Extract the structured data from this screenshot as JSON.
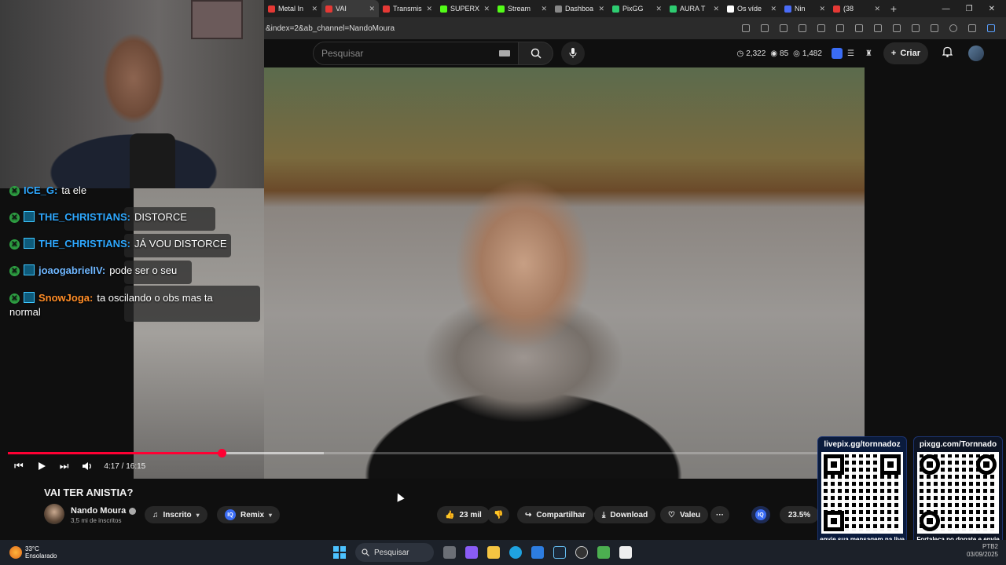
{
  "browser": {
    "tabs": [
      {
        "label": "Metal In",
        "color": "#e53935"
      },
      {
        "label": "VAI",
        "color": "#e53935",
        "active": true
      },
      {
        "label": "Transmis",
        "color": "#e53935"
      },
      {
        "label": "SUPERX",
        "color": "#53fc18"
      },
      {
        "label": "Stream",
        "color": "#53fc18"
      },
      {
        "label": "Dashboa",
        "color": "#888888"
      },
      {
        "label": "PixGG",
        "color": "#2ecc71"
      },
      {
        "label": "AURA T",
        "color": "#2ecc71"
      },
      {
        "label": "Os víde",
        "color": "#ffffff"
      },
      {
        "label": "Nin",
        "color": "#4a6cf7"
      },
      {
        "label": "(38",
        "color": "#e53935"
      }
    ],
    "new_tab": "+",
    "url": "&index=2&ab_channel=NandoMoura"
  },
  "youtube": {
    "search_placeholder": "Pesquisar",
    "stats": {
      "a": "2,322",
      "b": "85",
      "c": "1,482"
    },
    "create_label": "Criar"
  },
  "chat": [
    {
      "user": "ICE_G:",
      "msg": "ta ele",
      "color": "green"
    },
    {
      "user": "THE_CHRISTIANS:",
      "msg": "DISTORCE",
      "color": "green"
    },
    {
      "user": "THE_CHRISTIANS:",
      "msg": "JÁ VOU DISTORCE",
      "color": "green"
    },
    {
      "user": "joaogabrielIV:",
      "msg": "pode ser o seu",
      "color": "blue"
    },
    {
      "user": "SnowJoga:",
      "msg": "ta oscilando o obs mas ta",
      "msg2": "normal",
      "color": "orange"
    }
  ],
  "player": {
    "time": "4:17 / 16:15",
    "progress": 0.2636,
    "buffered": 0.39
  },
  "video": {
    "title": "VAI TER ANISTIA?",
    "channel": "Nando Moura",
    "subscribers": "3,5 mi de inscritos",
    "subscribe_label": "Inscrito",
    "remix_label": "Remix",
    "remix_badge": "IQ",
    "likes": "23 mil",
    "share_label": "Compartilhar",
    "download_label": "Download",
    "thanks_label": "Valeu",
    "more_label": "···",
    "iq_badge": "IQ",
    "percent": "23.5%"
  },
  "qr_cards": [
    {
      "title": "livepix.gg/tornnadoz",
      "footer": "envie sua mensagem na live via pix!"
    },
    {
      "title": "pixgg.com/Tornnado",
      "footer": "Fortaleça no donate e envie sua mensagem!"
    }
  ],
  "taskbar": {
    "temperature": "33°C",
    "condition": "Ensolarado",
    "search_label": "Pesquisar",
    "clock_lines": [
      "PTB2",
      "03/09/2025"
    ]
  }
}
